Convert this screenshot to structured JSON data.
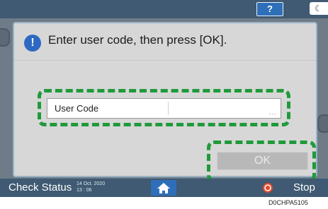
{
  "topbar": {
    "help_label": "?",
    "moon_icon": "crescent-moon-icon"
  },
  "dialog": {
    "icon": "info-icon",
    "icon_glyph": "!",
    "message": "Enter user code, then press [OK].",
    "field_label": "User Code",
    "field_value": "",
    "field_more": "...",
    "ok_label": "OK"
  },
  "bottombar": {
    "check_status": "Check Status",
    "date": "14 Oct. 2020",
    "time": "13 : 06",
    "home_icon": "home-icon",
    "stop_icon": "stop-icon",
    "stop_label": "Stop"
  },
  "figure_code": "D0CHPA5105",
  "colors": {
    "highlight": "#1f9a3a",
    "accent": "#2f6fb9",
    "stop": "#e04a2a"
  }
}
